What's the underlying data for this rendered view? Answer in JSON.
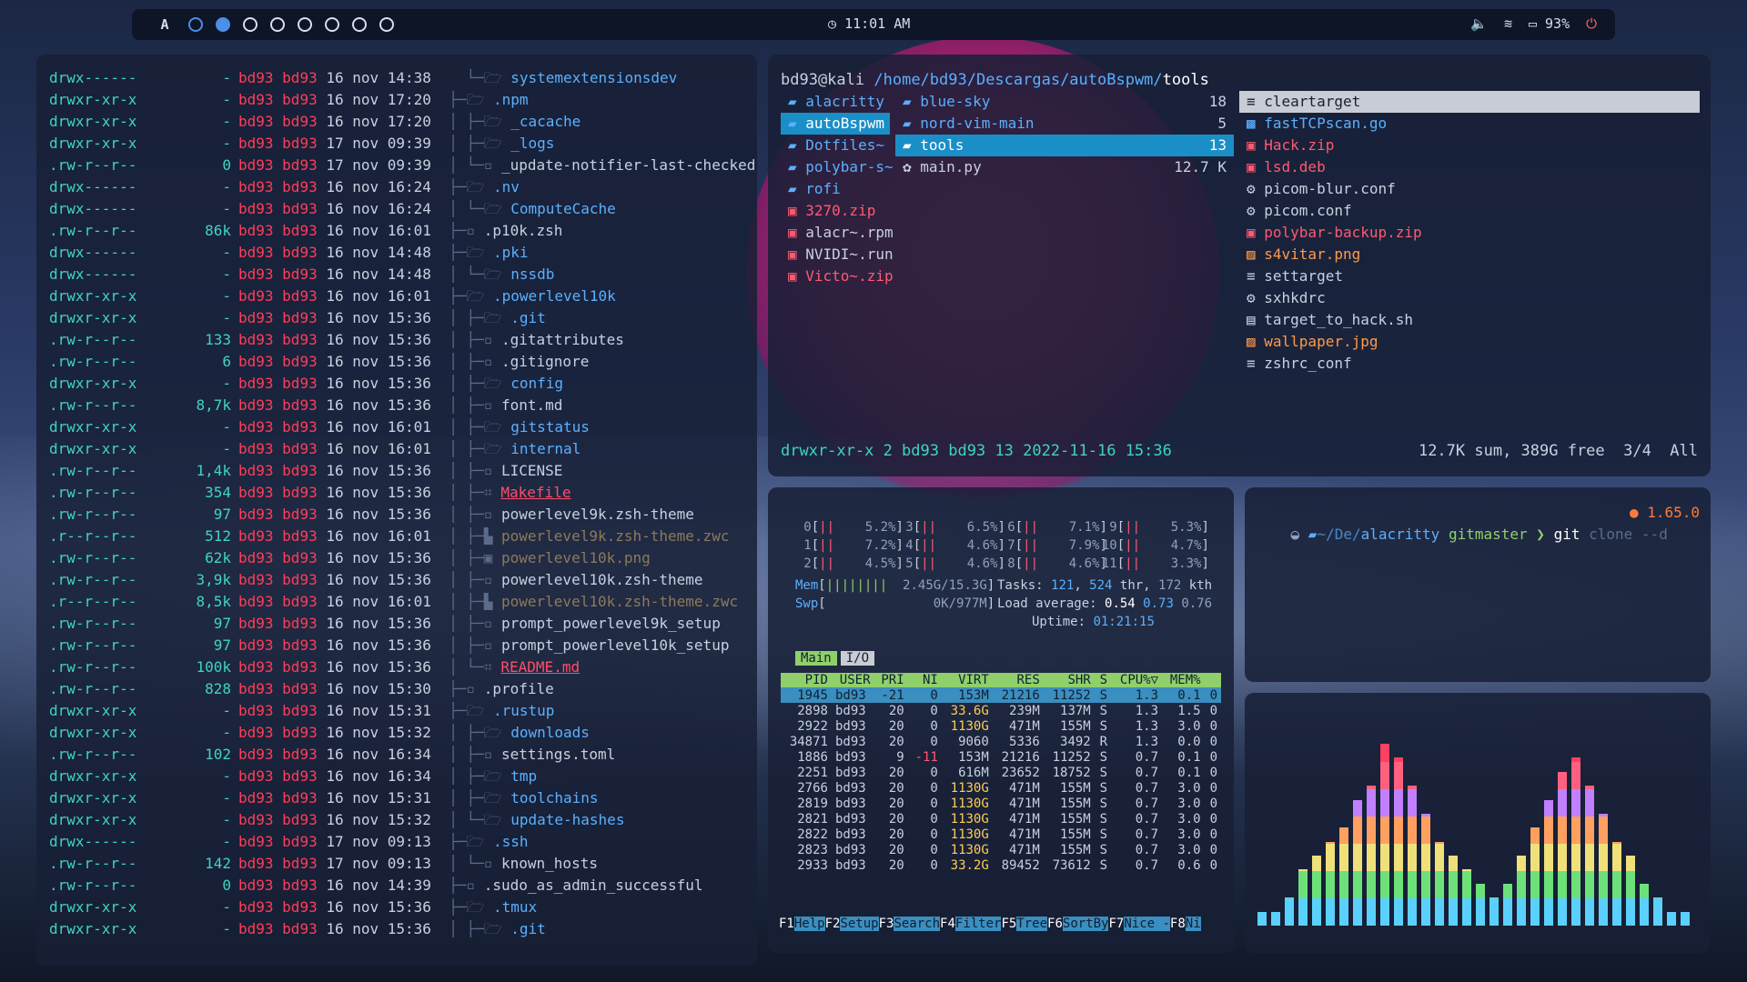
{
  "topbar": {
    "logo": "A",
    "clock": "11:01 AM",
    "battery": "93%",
    "workspaces": 8,
    "active_ws": 1
  },
  "left": {
    "rows": [
      [
        "drwx------",
        "-",
        "bd93",
        "bd93",
        "16 nov 14:38",
        "systemextensionsdev",
        "d",
        "  └─"
      ],
      [
        "drwxr-xr-x",
        "-",
        "bd93",
        "bd93",
        "16 nov 17:20",
        ".npm",
        "d",
        "├─"
      ],
      [
        "drwxr-xr-x",
        "-",
        "bd93",
        "bd93",
        "16 nov 17:20",
        "_cacache",
        "d",
        "│ ├─"
      ],
      [
        "drwxr-xr-x",
        "-",
        "bd93",
        "bd93",
        "17 nov 09:39",
        "_logs",
        "d",
        "│ ├─"
      ],
      [
        ".rw-r--r--",
        "0",
        "bd93",
        "bd93",
        "17 nov 09:39",
        "_update-notifier-last-checked",
        "f",
        "│ └─"
      ],
      [
        "drwx------",
        "-",
        "bd93",
        "bd93",
        "16 nov 16:24",
        ".nv",
        "d",
        "├─"
      ],
      [
        "drwx------",
        "-",
        "bd93",
        "bd93",
        "16 nov 16:24",
        "ComputeCache",
        "d",
        "│ └─"
      ],
      [
        ".rw-r--r--",
        "86k",
        "bd93",
        "bd93",
        "16 nov 16:01",
        ".p10k.zsh",
        "f",
        "├─"
      ],
      [
        "drwx------",
        "-",
        "bd93",
        "bd93",
        "16 nov 14:48",
        ".pki",
        "d",
        "├─"
      ],
      [
        "drwx------",
        "-",
        "bd93",
        "bd93",
        "16 nov 14:48",
        "nssdb",
        "d",
        "│ └─"
      ],
      [
        "drwxr-xr-x",
        "-",
        "bd93",
        "bd93",
        "16 nov 16:01",
        ".powerlevel10k",
        "d",
        "├─"
      ],
      [
        "drwxr-xr-x",
        "-",
        "bd93",
        "bd93",
        "16 nov 15:36",
        ".git",
        "d",
        "│ ├─"
      ],
      [
        ".rw-r--r--",
        "133",
        "bd93",
        "bd93",
        "16 nov 15:36",
        ".gitattributes",
        "f",
        "│ ├─"
      ],
      [
        ".rw-r--r--",
        "6",
        "bd93",
        "bd93",
        "16 nov 15:36",
        ".gitignore",
        "f",
        "│ ├─"
      ],
      [
        "drwxr-xr-x",
        "-",
        "bd93",
        "bd93",
        "16 nov 15:36",
        "config",
        "d",
        "│ ├─"
      ],
      [
        ".rw-r--r--",
        "8,7k",
        "bd93",
        "bd93",
        "16 nov 15:36",
        "font.md",
        "f",
        "│ ├─"
      ],
      [
        "drwxr-xr-x",
        "-",
        "bd93",
        "bd93",
        "16 nov 16:01",
        "gitstatus",
        "d",
        "│ ├─"
      ],
      [
        "drwxr-xr-x",
        "-",
        "bd93",
        "bd93",
        "16 nov 16:01",
        "internal",
        "d",
        "│ ├─"
      ],
      [
        ".rw-r--r--",
        "1,4k",
        "bd93",
        "bd93",
        "16 nov 15:36",
        "LICENSE",
        "f",
        "│ ├─"
      ],
      [
        ".rw-r--r--",
        "354",
        "bd93",
        "bd93",
        "16 nov 15:36",
        "Makefile",
        "h",
        "│ ├─"
      ],
      [
        ".rw-r--r--",
        "97",
        "bd93",
        "bd93",
        "16 nov 15:36",
        "powerlevel9k.zsh-theme",
        "f",
        "│ ├─"
      ],
      [
        ".r--r--r--",
        "512",
        "bd93",
        "bd93",
        "16 nov 16:01",
        "powerlevel9k.zsh-theme.zwc",
        "m",
        "│ ├─"
      ],
      [
        ".rw-r--r--",
        "62k",
        "bd93",
        "bd93",
        "16 nov 15:36",
        "powerlevel10k.png",
        "p",
        "│ ├─"
      ],
      [
        ".rw-r--r--",
        "3,9k",
        "bd93",
        "bd93",
        "16 nov 15:36",
        "powerlevel10k.zsh-theme",
        "f",
        "│ ├─"
      ],
      [
        ".r--r--r--",
        "8,5k",
        "bd93",
        "bd93",
        "16 nov 16:01",
        "powerlevel10k.zsh-theme.zwc",
        "m",
        "│ ├─"
      ],
      [
        ".rw-r--r--",
        "97",
        "bd93",
        "bd93",
        "16 nov 15:36",
        "prompt_powerlevel9k_setup",
        "f",
        "│ ├─"
      ],
      [
        ".rw-r--r--",
        "97",
        "bd93",
        "bd93",
        "16 nov 15:36",
        "prompt_powerlevel10k_setup",
        "f",
        "│ ├─"
      ],
      [
        ".rw-r--r--",
        "100k",
        "bd93",
        "bd93",
        "16 nov 15:36",
        "README.md",
        "h",
        "│ └─"
      ],
      [
        ".rw-r--r--",
        "828",
        "bd93",
        "bd93",
        "16 nov 15:30",
        ".profile",
        "f",
        "├─"
      ],
      [
        "drwxr-xr-x",
        "-",
        "bd93",
        "bd93",
        "16 nov 15:31",
        ".rustup",
        "d",
        "├─"
      ],
      [
        "drwxr-xr-x",
        "-",
        "bd93",
        "bd93",
        "16 nov 15:32",
        "downloads",
        "d",
        "│ ├─"
      ],
      [
        ".rw-r--r--",
        "102",
        "bd93",
        "bd93",
        "16 nov 16:34",
        "settings.toml",
        "f",
        "│ ├─"
      ],
      [
        "drwxr-xr-x",
        "-",
        "bd93",
        "bd93",
        "16 nov 16:34",
        "tmp",
        "d",
        "│ ├─"
      ],
      [
        "drwxr-xr-x",
        "-",
        "bd93",
        "bd93",
        "16 nov 15:31",
        "toolchains",
        "d",
        "│ ├─"
      ],
      [
        "drwxr-xr-x",
        "-",
        "bd93",
        "bd93",
        "16 nov 15:32",
        "update-hashes",
        "d",
        "│ └─"
      ],
      [
        "drwx------",
        "-",
        "bd93",
        "bd93",
        "17 nov 09:13",
        ".ssh",
        "d",
        "├─"
      ],
      [
        ".rw-r--r--",
        "142",
        "bd93",
        "bd93",
        "17 nov 09:13",
        "known_hosts",
        "f",
        "│ └─"
      ],
      [
        ".rw-r--r--",
        "0",
        "bd93",
        "bd93",
        "16 nov 14:39",
        ".sudo_as_admin_successful",
        "f",
        "├─"
      ],
      [
        "drwxr-xr-x",
        "-",
        "bd93",
        "bd93",
        "16 nov 15:36",
        ".tmux",
        "d",
        "├─"
      ],
      [
        "drwxr-xr-x",
        "-",
        "bd93",
        "bd93",
        "16 nov 15:36",
        ".git",
        "d",
        "│ ├─"
      ]
    ]
  },
  "ranger": {
    "path_user": "bd93@kali",
    "path_dir": "/home/bd93/Descargas/autoBspwm/",
    "path_cur": "tools",
    "col1": [
      "alacritty",
      "autoBspwm",
      "Dotfiles~",
      "polybar-s~",
      "rofi",
      "3270.zip",
      "alacr~.rpm",
      "NVIDI~.run",
      "Victo~.zip"
    ],
    "col2": [
      [
        "blue-sky",
        "18"
      ],
      [
        "nord-vim-main",
        "5"
      ],
      [
        "tools",
        "13"
      ],
      [
        "main.py",
        "12.7 K"
      ]
    ],
    "col3": [
      "cleartarget",
      "fastTCPscan.go",
      "Hack.zip",
      "lsd.deb",
      "picom-blur.conf",
      "picom.conf",
      "polybar-backup.zip",
      "s4vitar.png",
      "settarget",
      "sxhkdrc",
      "target_to_hack.sh",
      "wallpaper.jpg",
      "zshrc_conf"
    ],
    "status_left": "drwxr-xr-x 2 bd93 bd93 13 2022-11-16 15:36",
    "status_right": "12.7K sum, 389G free  3/4  All"
  },
  "htop": {
    "cpus": [
      [
        "0",
        "5.2%"
      ],
      [
        "3",
        "6.5%"
      ],
      [
        "6",
        "7.1%"
      ],
      [
        "9",
        "5.3%"
      ],
      [
        "1",
        "7.2%"
      ],
      [
        "4",
        "4.6%"
      ],
      [
        "7",
        "7.9%"
      ],
      [
        "10",
        "4.7%"
      ],
      [
        "2",
        "4.5%"
      ],
      [
        "5",
        "4.6%"
      ],
      [
        "8",
        "4.6%"
      ],
      [
        "11",
        "3.3%"
      ]
    ],
    "mem": "2.45G/15.3G",
    "swp": "0K/977M",
    "tasks": "121",
    "thr": "524",
    "kth": "172",
    "load1": "0.54",
    "load5": "0.73",
    "load15": "0.76",
    "uptime": "01:21:15",
    "tabs": [
      "Main",
      "I/O"
    ],
    "headers": [
      "PID",
      "USER",
      "PRI",
      "NI",
      "VIRT",
      "RES",
      "SHR",
      "S",
      "CPU%▽",
      "MEM%",
      ""
    ],
    "procs": [
      [
        "1945",
        "bd93",
        "-21",
        "0",
        "153M",
        "21216",
        "11252",
        "S",
        "1.3",
        "0.1",
        "0"
      ],
      [
        "2898",
        "bd93",
        "20",
        "0",
        "33.6G",
        "239M",
        "137M",
        "S",
        "1.3",
        "1.5",
        "0"
      ],
      [
        "2922",
        "bd93",
        "20",
        "0",
        "1130G",
        "471M",
        "155M",
        "S",
        "1.3",
        "3.0",
        "0"
      ],
      [
        "34871",
        "bd93",
        "20",
        "0",
        "9060",
        "5336",
        "3492",
        "R",
        "1.3",
        "0.0",
        "0"
      ],
      [
        "1886",
        "bd93",
        "9",
        "-11",
        "153M",
        "21216",
        "11252",
        "S",
        "0.7",
        "0.1",
        "0"
      ],
      [
        "2251",
        "bd93",
        "20",
        "0",
        "616M",
        "23652",
        "18752",
        "S",
        "0.7",
        "0.1",
        "0"
      ],
      [
        "2766",
        "bd93",
        "20",
        "0",
        "1130G",
        "471M",
        "155M",
        "S",
        "0.7",
        "3.0",
        "0"
      ],
      [
        "2819",
        "bd93",
        "20",
        "0",
        "1130G",
        "471M",
        "155M",
        "S",
        "0.7",
        "3.0",
        "0"
      ],
      [
        "2821",
        "bd93",
        "20",
        "0",
        "1130G",
        "471M",
        "155M",
        "S",
        "0.7",
        "3.0",
        "0"
      ],
      [
        "2822",
        "bd93",
        "20",
        "0",
        "1130G",
        "471M",
        "155M",
        "S",
        "0.7",
        "3.0",
        "0"
      ],
      [
        "2823",
        "bd93",
        "20",
        "0",
        "1130G",
        "471M",
        "155M",
        "S",
        "0.7",
        "3.0",
        "0"
      ],
      [
        "2933",
        "bd93",
        "20",
        "0",
        "33.2G",
        "89452",
        "73612",
        "S",
        "0.7",
        "0.6",
        "0"
      ]
    ],
    "fkeys": [
      [
        "F1",
        "Help"
      ],
      [
        "F2",
        "Setup"
      ],
      [
        "F3",
        "Search"
      ],
      [
        "F4",
        "Filter"
      ],
      [
        "F5",
        "Tree"
      ],
      [
        "F6",
        "SortBy"
      ],
      [
        "F7",
        "Nice -"
      ],
      [
        "F8",
        "Ni"
      ]
    ]
  },
  "terminal": {
    "dir_prefix": "~/De/",
    "dir": "alacritty",
    "git": "master",
    "prompt": "❯",
    "cmd": "git",
    "suggest": "clone --d",
    "version": "1.65.0"
  },
  "visualizer": {
    "levels": [
      1,
      1,
      2,
      4,
      5,
      6,
      7,
      9,
      10,
      13,
      12,
      10,
      8,
      6,
      5,
      4,
      3,
      2,
      3,
      5,
      7,
      9,
      11,
      12,
      10,
      8,
      6,
      5,
      3,
      2,
      1,
      1
    ]
  }
}
